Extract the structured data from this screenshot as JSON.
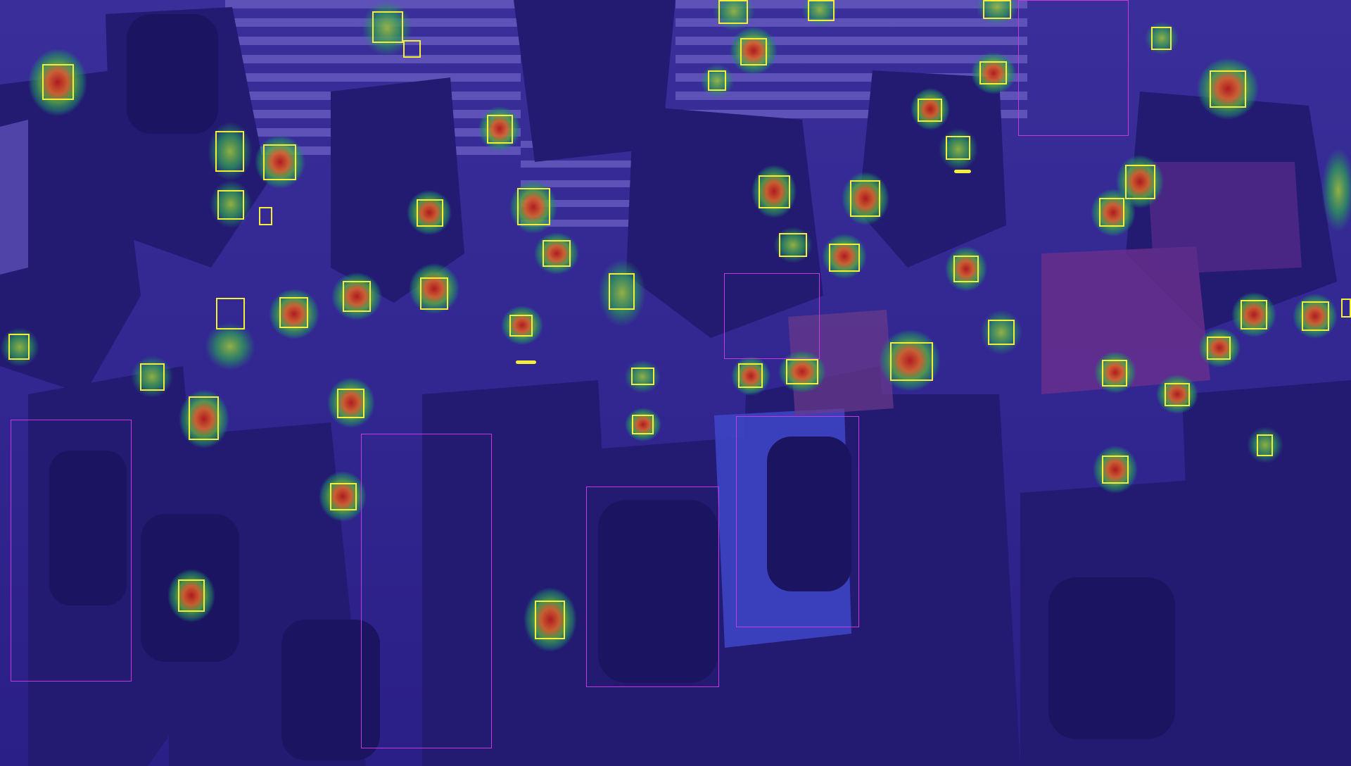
{
  "scene": {
    "description_kind": "crowd-heatmap-overlay",
    "tint_color": "#2e238f",
    "stair_color": "#5e52b8",
    "heat_colors": [
      "#1f8a6a",
      "#44b64c",
      "#c9c43a",
      "#d9672a",
      "#b71a1a"
    ],
    "head_box_color": "#f2ee3a",
    "body_box_color": "#c23bdf"
  }
}
